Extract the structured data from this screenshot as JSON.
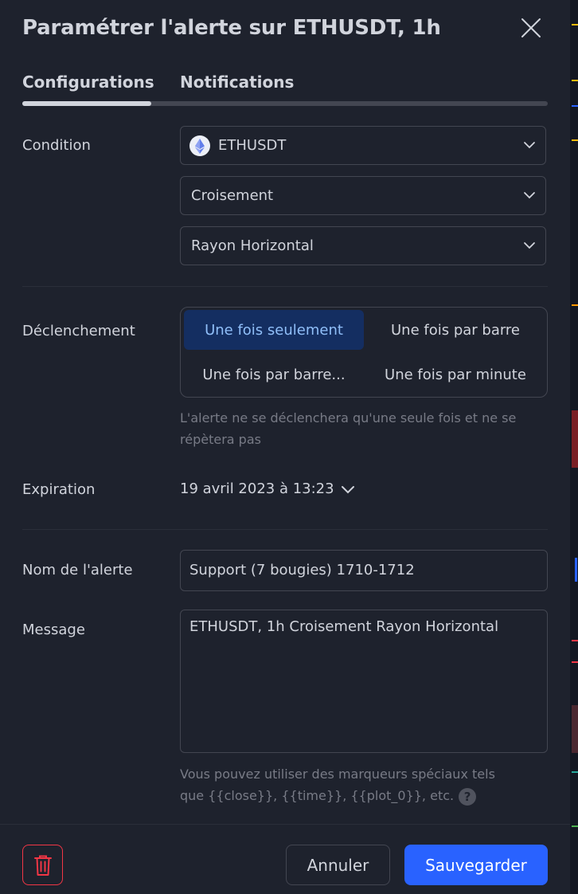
{
  "dialog": {
    "title": "Paramétrer l'alerte sur ETHUSDT, 1h"
  },
  "tabs": [
    {
      "label": "Configurations",
      "active": true
    },
    {
      "label": "Notifications",
      "active": false
    }
  ],
  "condition": {
    "label": "Condition",
    "symbol": "ETHUSDT",
    "operator": "Croisement",
    "target": "Rayon Horizontal"
  },
  "trigger": {
    "label": "Déclenchement",
    "options": [
      "Une fois seulement",
      "Une fois par barre",
      "Une fois par barre...",
      "Une fois par minute"
    ],
    "selected": "Une fois seulement",
    "hint_line1": "L'alerte ne se déclenchera qu'une seule fois et ne se",
    "hint_line2": "répètera pas"
  },
  "expiration": {
    "label": "Expiration",
    "value": "19 avril 2023 à 13:23"
  },
  "alert_name": {
    "label": "Nom de l'alerte",
    "value": "Support (7 bougies) 1710-1712"
  },
  "message": {
    "label": "Message",
    "value": "ETHUSDT, 1h Croisement Rayon Horizontal",
    "hint_line1": "Vous pouvez utiliser des marqueurs spéciaux tels",
    "hint_line2": "que {{close}}, {{time}}, {{plot_0}}, etc.",
    "help": "?"
  },
  "footer": {
    "cancel_label": "Annuler",
    "save_label": "Sauvegarder"
  },
  "colors": {
    "background": "#1e222d",
    "accent": "#2962ff",
    "active_segment": "#142e61",
    "danger": "#f23645"
  }
}
